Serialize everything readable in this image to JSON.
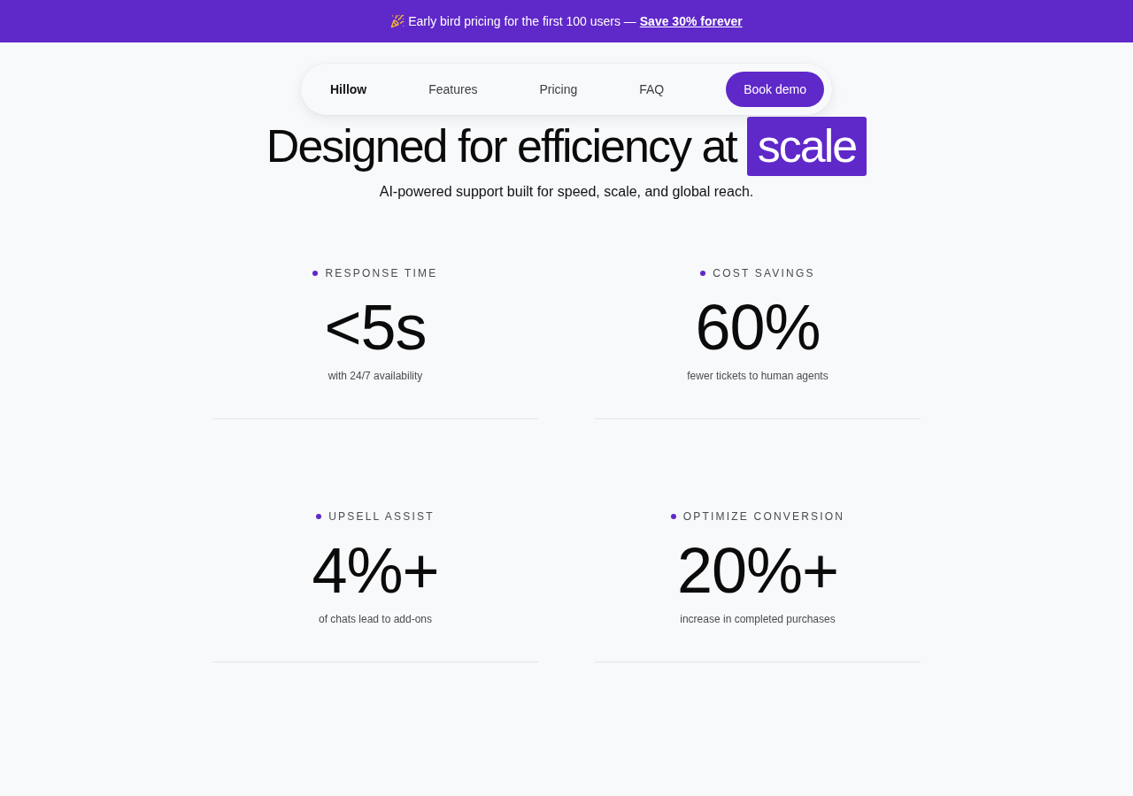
{
  "promo_banner": {
    "text": "Early bird pricing for the first 100 users —",
    "link": "Save 30% forever"
  },
  "nav": {
    "brand": "Hillow",
    "links": [
      "Features",
      "Pricing",
      "FAQ"
    ],
    "cta": "Book demo"
  },
  "hero": {
    "title": "Designed for efficiency at",
    "highlight": "scale",
    "subtitle": "AI-powered support built for speed, scale, and global reach."
  },
  "stats": [
    {
      "label": "RESPONSE TIME",
      "value": "<5s",
      "caption": "with 24/7 availability"
    },
    {
      "label": "COST SAVINGS",
      "value": "60%",
      "caption": "fewer tickets to human agents"
    },
    {
      "label": "UPSELL ASSIST",
      "value": "4%+",
      "caption": "of chats lead to add-ons"
    },
    {
      "label": "OPTIMIZE CONVERSION",
      "value": "20%+",
      "caption": "increase in completed purchases"
    }
  ]
}
